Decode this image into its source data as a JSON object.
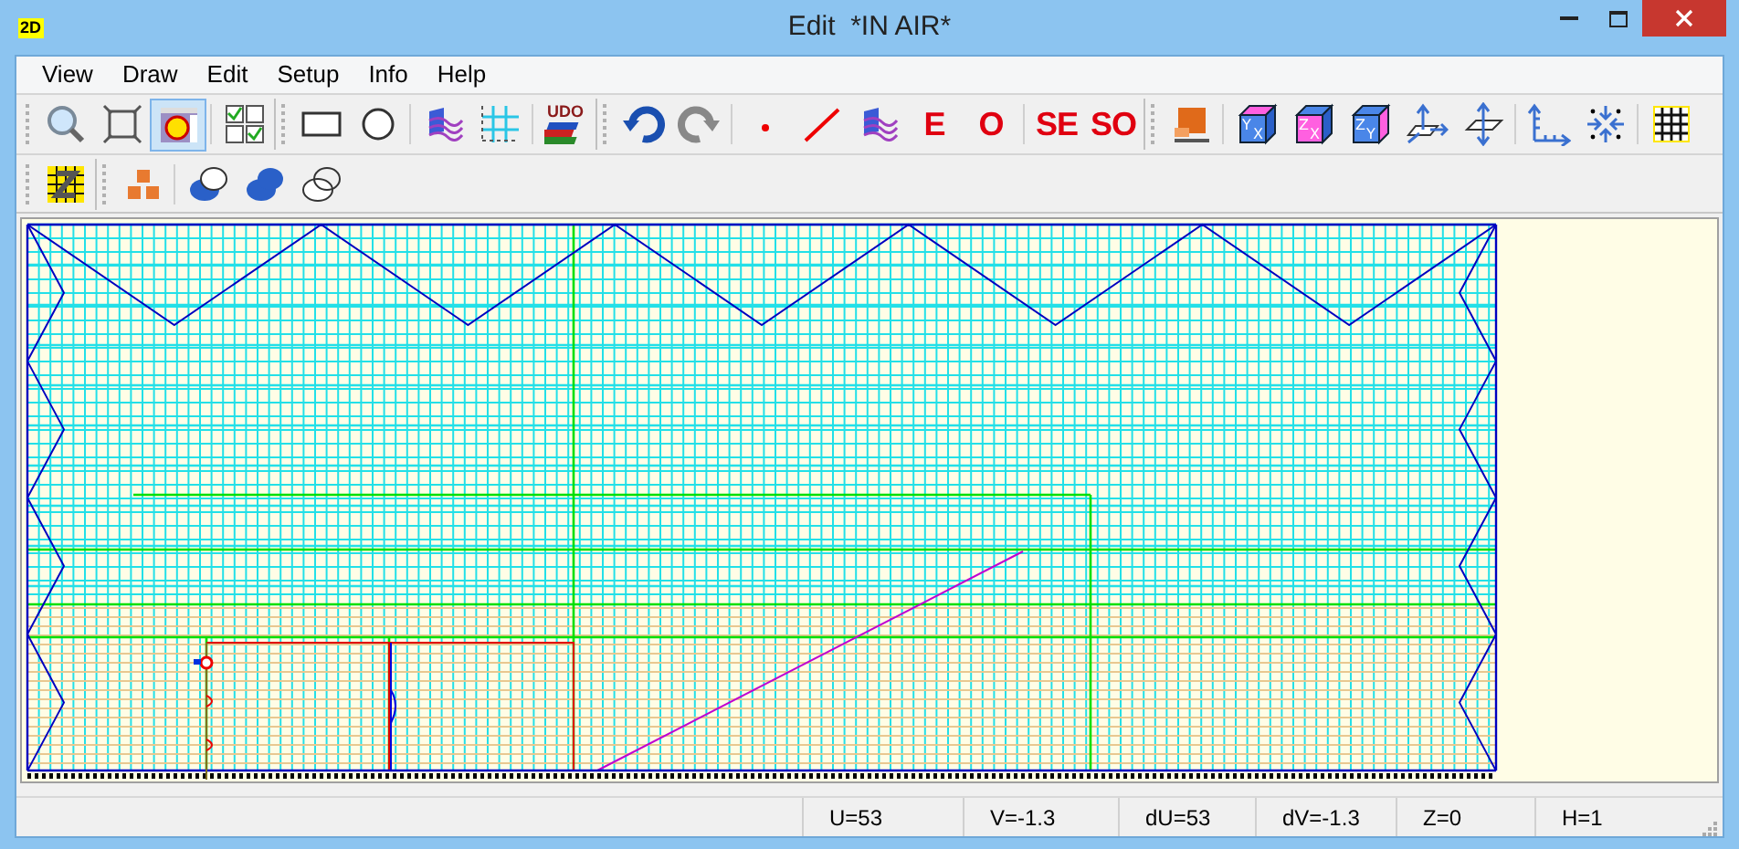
{
  "window": {
    "title": "Edit  *IN AIR*",
    "app_badge": "2D"
  },
  "menu": [
    "View",
    "Draw",
    "Edit",
    "Setup",
    "Info",
    "Help"
  ],
  "toolbars": [
    [
      [
        {
          "kind": "zoom",
          "selected": false
        },
        {
          "kind": "fit",
          "selected": false
        },
        {
          "kind": "layer",
          "selected": true
        },
        {
          "kind": "sep"
        },
        {
          "kind": "checkgrid",
          "selected": false
        }
      ],
      [
        {
          "kind": "rect",
          "selected": false
        },
        {
          "kind": "circle",
          "selected": false
        },
        {
          "kind": "sep"
        },
        {
          "kind": "wave",
          "selected": false
        },
        {
          "kind": "gridlines",
          "selected": false
        },
        {
          "kind": "sep"
        },
        {
          "kind": "books",
          "label": "UDO",
          "selected": false
        }
      ],
      [
        {
          "kind": "undo",
          "selected": false
        },
        {
          "kind": "redo",
          "selected": false
        },
        {
          "kind": "sep"
        },
        {
          "kind": "point",
          "selected": false
        },
        {
          "kind": "line",
          "selected": false
        },
        {
          "kind": "wave",
          "selected": false
        },
        {
          "kind": "letter",
          "label": "E",
          "selected": false
        },
        {
          "kind": "letter",
          "label": "O",
          "selected": false
        },
        {
          "kind": "sep"
        },
        {
          "kind": "letter",
          "label": "SE",
          "selected": false
        },
        {
          "kind": "letter",
          "label": "SO",
          "selected": false
        }
      ],
      [
        {
          "kind": "block",
          "selected": false
        },
        {
          "kind": "sep"
        },
        {
          "kind": "cube_top",
          "label": "Y",
          "sub": "X",
          "selected": false
        },
        {
          "kind": "cube_front",
          "label": "Z",
          "sub": "X",
          "selected": false
        },
        {
          "kind": "cube_side",
          "label": "Z",
          "sub": "Y",
          "selected": false
        },
        {
          "kind": "planeh",
          "selected": false
        },
        {
          "kind": "planev",
          "selected": false
        },
        {
          "kind": "sep"
        },
        {
          "kind": "axes",
          "selected": false
        },
        {
          "kind": "snap",
          "selected": false
        },
        {
          "kind": "sep"
        },
        {
          "kind": "grid",
          "selected": false
        }
      ]
    ],
    [
      [
        {
          "kind": "zgrid",
          "selected": false
        }
      ],
      [
        {
          "kind": "blocks",
          "selected": false
        },
        {
          "kind": "sep"
        },
        {
          "kind": "union",
          "selected": false
        },
        {
          "kind": "merge",
          "selected": false
        },
        {
          "kind": "intersect",
          "selected": false
        }
      ]
    ]
  ],
  "status_bar": [
    "U=53",
    "V=-1.3",
    "dU=53",
    "dV=-1.3",
    "Z=0",
    "H=1"
  ]
}
